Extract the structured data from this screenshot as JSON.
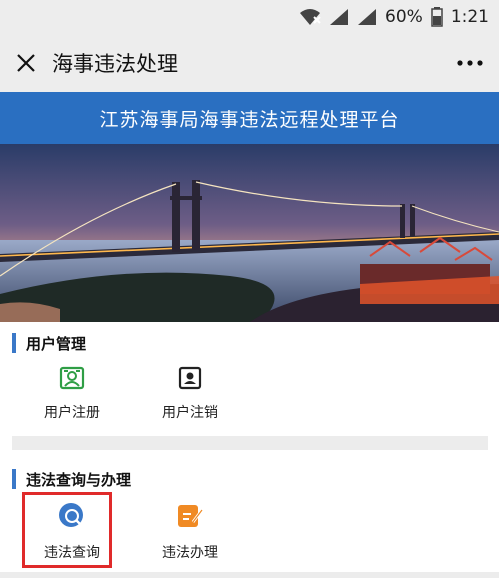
{
  "status_bar": {
    "battery_percent": "60%",
    "time": "1:21"
  },
  "nav": {
    "title": "海事违法处理"
  },
  "banner": {
    "title": "江苏海事局海事违法远程处理平台"
  },
  "sections": [
    {
      "title": "用户管理",
      "items": [
        {
          "label": "用户注册",
          "icon": "id-card-icon",
          "color": "#2f9e45"
        },
        {
          "label": "用户注销",
          "icon": "user-square-icon",
          "color": "#222222"
        }
      ]
    },
    {
      "title": "违法查询与办理",
      "items": [
        {
          "label": "违法查询",
          "icon": "violation-search-icon",
          "color": "#3a78c8"
        },
        {
          "label": "违法办理",
          "icon": "edit-doc-icon",
          "color": "#f08a24"
        }
      ]
    }
  ],
  "colors": {
    "accent": "#2a6fc1",
    "highlight": "#e02a2a"
  }
}
